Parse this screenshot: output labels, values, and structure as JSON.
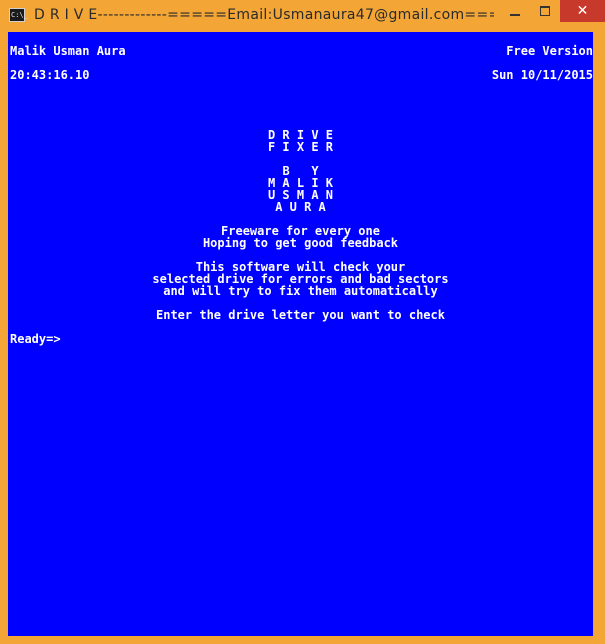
{
  "window": {
    "title": "D R I V E-------------=====Email:Usmanaura47@gmail.com====...",
    "icon": "console-icon",
    "icon_glyph": "C:\\_",
    "close_glyph": "✕"
  },
  "console": {
    "author": "Malik Usman Aura",
    "edition": "Free Version",
    "time": "20:43:16.10",
    "date": "Sun 10/11/2015",
    "banner": [
      "D R I V E",
      "F I X E R",
      "B   Y",
      "M A L I K",
      "U S M A N",
      "A U R A"
    ],
    "tagline": [
      "Freeware for every one",
      "Hoping to get good feedback"
    ],
    "description": [
      "This software will check your",
      "selected drive for errors and bad sectors",
      "and will try to fix them automatically"
    ],
    "instruction": "Enter the drive letter you want to check",
    "prompt": "Ready=>"
  },
  "colors": {
    "console_background": "#0000ff",
    "console_text": "#ffffff",
    "window_frame": "#f3a536",
    "close_button": "#c7392b"
  }
}
